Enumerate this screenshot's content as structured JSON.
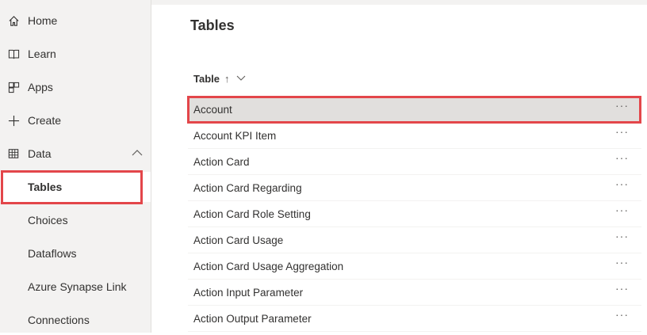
{
  "sidebar": {
    "items": [
      {
        "label": "Home",
        "icon": "home-icon"
      },
      {
        "label": "Learn",
        "icon": "book-icon"
      },
      {
        "label": "Apps",
        "icon": "apps-icon"
      },
      {
        "label": "Create",
        "icon": "plus-icon"
      },
      {
        "label": "Data",
        "icon": "table-icon",
        "expanded": true
      }
    ],
    "data_children": [
      {
        "label": "Tables",
        "selected": true
      },
      {
        "label": "Choices"
      },
      {
        "label": "Dataflows"
      },
      {
        "label": "Azure Synapse Link"
      },
      {
        "label": "Connections"
      }
    ]
  },
  "main": {
    "title": "Tables",
    "column_header": "Table",
    "sort_indicator": "↑",
    "more_glyph": "···",
    "rows": [
      "Account",
      "Account KPI Item",
      "Action Card",
      "Action Card Regarding",
      "Action Card Role Setting",
      "Action Card Usage",
      "Action Card Usage Aggregation",
      "Action Input Parameter",
      "Action Output Parameter"
    ]
  },
  "colors": {
    "highlight": "#e3464a",
    "sidebar_bg": "#f3f2f1",
    "selected_row_bg": "#e1dfdd"
  }
}
